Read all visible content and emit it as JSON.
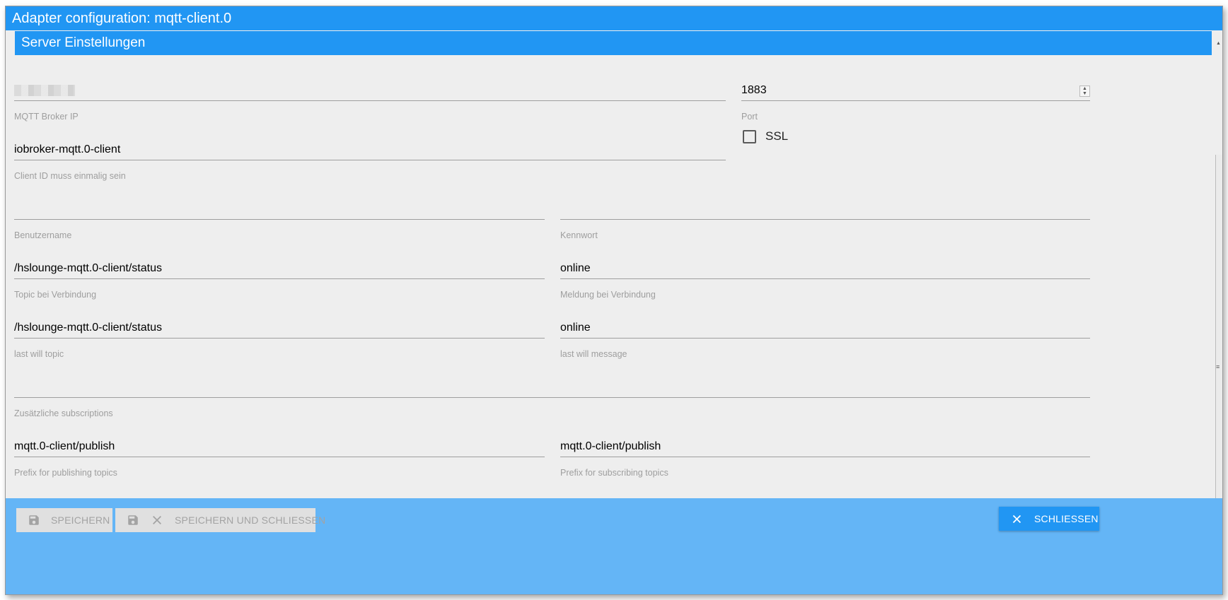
{
  "window": {
    "title": "Adapter configuration: mqtt-client.0"
  },
  "section": {
    "title": "Server Einstellungen"
  },
  "fields": {
    "broker_ip": {
      "value": "",
      "label": "MQTT Broker IP"
    },
    "port": {
      "value": "1883",
      "label": "Port"
    },
    "client_id": {
      "value": "iobroker-mqtt.0-client",
      "label": "Client ID muss einmalig sein"
    },
    "username": {
      "value": "",
      "label": "Benutzername"
    },
    "password": {
      "value": "",
      "label": "Kennwort"
    },
    "connect_topic": {
      "value": "/hslounge-mqtt.0-client/status",
      "label": "Topic bei Verbindung"
    },
    "connect_message": {
      "value": "online",
      "label": "Meldung bei Verbindung"
    },
    "last_will_topic": {
      "value": "/hslounge-mqtt.0-client/status",
      "label": "last will topic"
    },
    "last_will_message": {
      "value": "online",
      "label": "last will message"
    },
    "subscriptions": {
      "value": "",
      "label": "Zusätzliche subscriptions"
    },
    "publish_prefix": {
      "value": "mqtt.0-client/publish",
      "label": "Prefix for publishing topics"
    },
    "subscribe_prefix": {
      "value": "mqtt.0-client/publish",
      "label": "Prefix for subscribing topics"
    }
  },
  "ssl": {
    "label": "SSL",
    "checked": false
  },
  "footer": {
    "save_label": "SPEICHERN",
    "save_close_label": "SPEICHERN UND SCHLIESSEN",
    "close_label": "SCHLIESSEN"
  },
  "colors": {
    "primary": "#2196f3",
    "footer_bg": "#64b5f6",
    "background": "#eeeeee",
    "disabled_button": "#e0e0e0",
    "label_grey": "#9e9e9e"
  },
  "icons": [
    "floppy-disk-icon",
    "close-icon",
    "spinner-arrows-icon",
    "checkbox-icon"
  ]
}
